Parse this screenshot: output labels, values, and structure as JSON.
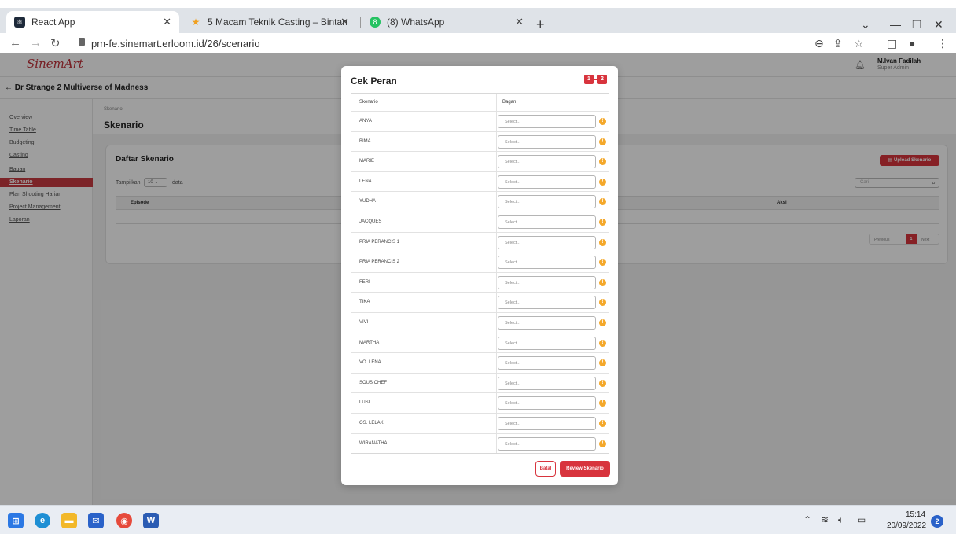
{
  "browser": {
    "tabs": [
      {
        "title": "React App"
      },
      {
        "title": "5 Macam Teknik Casting – Bintan"
      },
      {
        "title": "(8) WhatsApp"
      }
    ],
    "new_tab_glyph": "+",
    "url": "pm-fe.sinemart.erloom.id/26/scenario"
  },
  "app": {
    "logo": "SinemArt",
    "user": {
      "name": "M.Ivan Fadilah",
      "role": "Super Admin"
    },
    "project_title": "← Dr Strange 2 Multiverse of Madness",
    "sidebar": {
      "items": [
        {
          "label": "Overview"
        },
        {
          "label": "Time Table"
        },
        {
          "label": "Budgeting"
        },
        {
          "label": "Casting"
        },
        {
          "label": "Bagan"
        },
        {
          "label": "Skenario",
          "active": true
        },
        {
          "label": "Plan Shooting Harian"
        },
        {
          "label": "Project Management"
        },
        {
          "label": "Laporan"
        }
      ]
    },
    "breadcrumb": "Skenario",
    "page_title": "Skenario",
    "card": {
      "title": "Daftar Skenario",
      "show_label": "Tampilkan",
      "show_value": "10",
      "show_suffix": "data",
      "upload_label": "Upload Skenario",
      "search_placeholder": "Cari",
      "columns": [
        "Episode",
        "Aksi"
      ],
      "pager": {
        "prev": "Previous",
        "page": "1",
        "next": "Next"
      }
    }
  },
  "modal": {
    "title": "Cek Peran",
    "steps": [
      "1",
      "2"
    ],
    "columns": {
      "scenario": "Skenario",
      "chart": "Bagan"
    },
    "select_placeholder": "Select...",
    "rows": [
      "ANYA",
      "BIMA",
      "MARIE",
      "LENA",
      "YUDHA",
      "JACQUES",
      "PRIA PERANCIS 1",
      "PRIA PERANCIS 2",
      "FERI",
      "TIKA",
      "VIVI",
      "MARTHA",
      "VO. LENA",
      "SOUS CHEF",
      "LUSI",
      "OS. LELAKI",
      "WIRANATHA"
    ],
    "cancel_label": "Batal",
    "review_label": "Review Skenario"
  },
  "taskbar": {
    "time": "15:14",
    "date": "20/09/2022",
    "notification_count": "2"
  },
  "icons": {
    "warning": "warning-icon",
    "search": "search-icon",
    "bell": "bell-icon"
  },
  "colors": {
    "accent": "#d8343d",
    "warning": "#f4a82a"
  }
}
